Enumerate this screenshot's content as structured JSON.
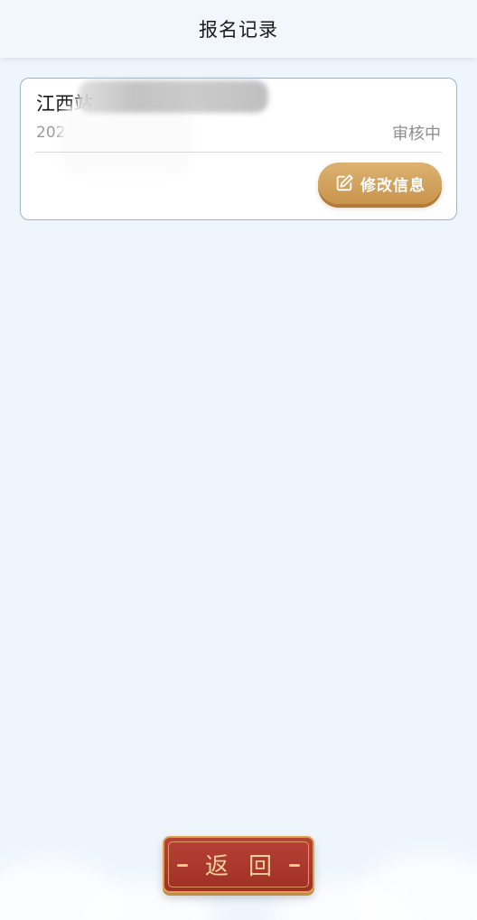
{
  "header": {
    "title": "报名记录"
  },
  "records": [
    {
      "title": "江西站",
      "date": "202",
      "status": "审核中",
      "edit_label": "修改信息"
    }
  ],
  "footer": {
    "back_label": "返回"
  },
  "colors": {
    "background": "#eef5fd",
    "edit_button": "#d3a560",
    "back_button": "#a83a2f",
    "back_button_border": "#d9a34f",
    "status_text": "#8e8e8e"
  },
  "icons": {
    "edit": "edit-pencil-icon"
  }
}
